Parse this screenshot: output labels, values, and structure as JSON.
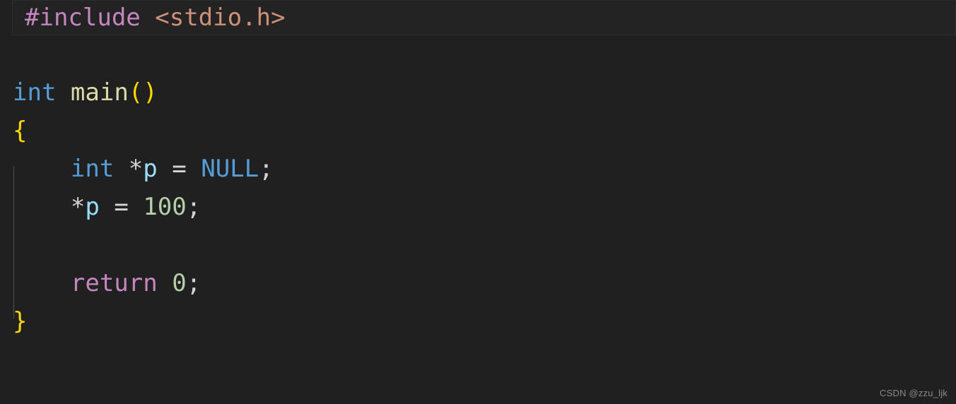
{
  "editor": {
    "background_color": "#202020",
    "language": "c",
    "font_size_px": 34,
    "watermark": "CSDN @zzu_ljk"
  },
  "theme": {
    "background": "#202020",
    "highlight_line_background": "#232323",
    "highlight_line_border": "#2c2c2c",
    "indent_guide": "#5a5a5a",
    "foreground": "#d4d4d4",
    "preprocessor": "#c586c0",
    "include_path": "#ce9178",
    "keyword": "#569cd6",
    "type": "#569cd6",
    "function": "#dcdcaa",
    "bracket": "#ffd700",
    "variable": "#9cdcfe",
    "number": "#b5cea8",
    "punctuation": "#d4d4d4"
  },
  "code": {
    "lines": [
      {
        "index": 1,
        "highlighted": true,
        "text": "#include <stdio.h>",
        "tokens": [
          {
            "text": "#include",
            "kind": "preproc"
          },
          {
            "text": " ",
            "kind": "plain"
          },
          {
            "text": "<stdio.h>",
            "kind": "include"
          }
        ]
      },
      {
        "index": 2,
        "highlighted": false,
        "text": "",
        "tokens": []
      },
      {
        "index": 3,
        "highlighted": false,
        "text": "int main()",
        "tokens": [
          {
            "text": "int",
            "kind": "type"
          },
          {
            "text": " ",
            "kind": "plain"
          },
          {
            "text": "main",
            "kind": "func"
          },
          {
            "text": "()",
            "kind": "bracket"
          }
        ]
      },
      {
        "index": 4,
        "highlighted": false,
        "text": "{",
        "tokens": [
          {
            "text": "{",
            "kind": "brace"
          }
        ]
      },
      {
        "index": 5,
        "highlighted": false,
        "text": "    int *p = NULL;",
        "tokens": [
          {
            "text": "    ",
            "kind": "plain"
          },
          {
            "text": "int",
            "kind": "type"
          },
          {
            "text": " ",
            "kind": "plain"
          },
          {
            "text": "*",
            "kind": "op"
          },
          {
            "text": "p",
            "kind": "var"
          },
          {
            "text": " ",
            "kind": "plain"
          },
          {
            "text": "=",
            "kind": "op"
          },
          {
            "text": " ",
            "kind": "plain"
          },
          {
            "text": "NULL",
            "kind": "const"
          },
          {
            "text": ";",
            "kind": "punct"
          }
        ]
      },
      {
        "index": 6,
        "highlighted": false,
        "text": "    *p = 100;",
        "tokens": [
          {
            "text": "    ",
            "kind": "plain"
          },
          {
            "text": "*",
            "kind": "op"
          },
          {
            "text": "p",
            "kind": "var"
          },
          {
            "text": " ",
            "kind": "plain"
          },
          {
            "text": "=",
            "kind": "op"
          },
          {
            "text": " ",
            "kind": "plain"
          },
          {
            "text": "100",
            "kind": "number"
          },
          {
            "text": ";",
            "kind": "punct"
          }
        ]
      },
      {
        "index": 7,
        "highlighted": false,
        "text": "",
        "tokens": []
      },
      {
        "index": 8,
        "highlighted": false,
        "text": "    return 0;",
        "tokens": [
          {
            "text": "    ",
            "kind": "plain"
          },
          {
            "text": "return",
            "kind": "keyword-return"
          },
          {
            "text": " ",
            "kind": "plain"
          },
          {
            "text": "0",
            "kind": "number"
          },
          {
            "text": ";",
            "kind": "punct"
          }
        ]
      },
      {
        "index": 9,
        "highlighted": false,
        "text": "}",
        "tokens": [
          {
            "text": "}",
            "kind": "brace"
          }
        ]
      }
    ]
  }
}
